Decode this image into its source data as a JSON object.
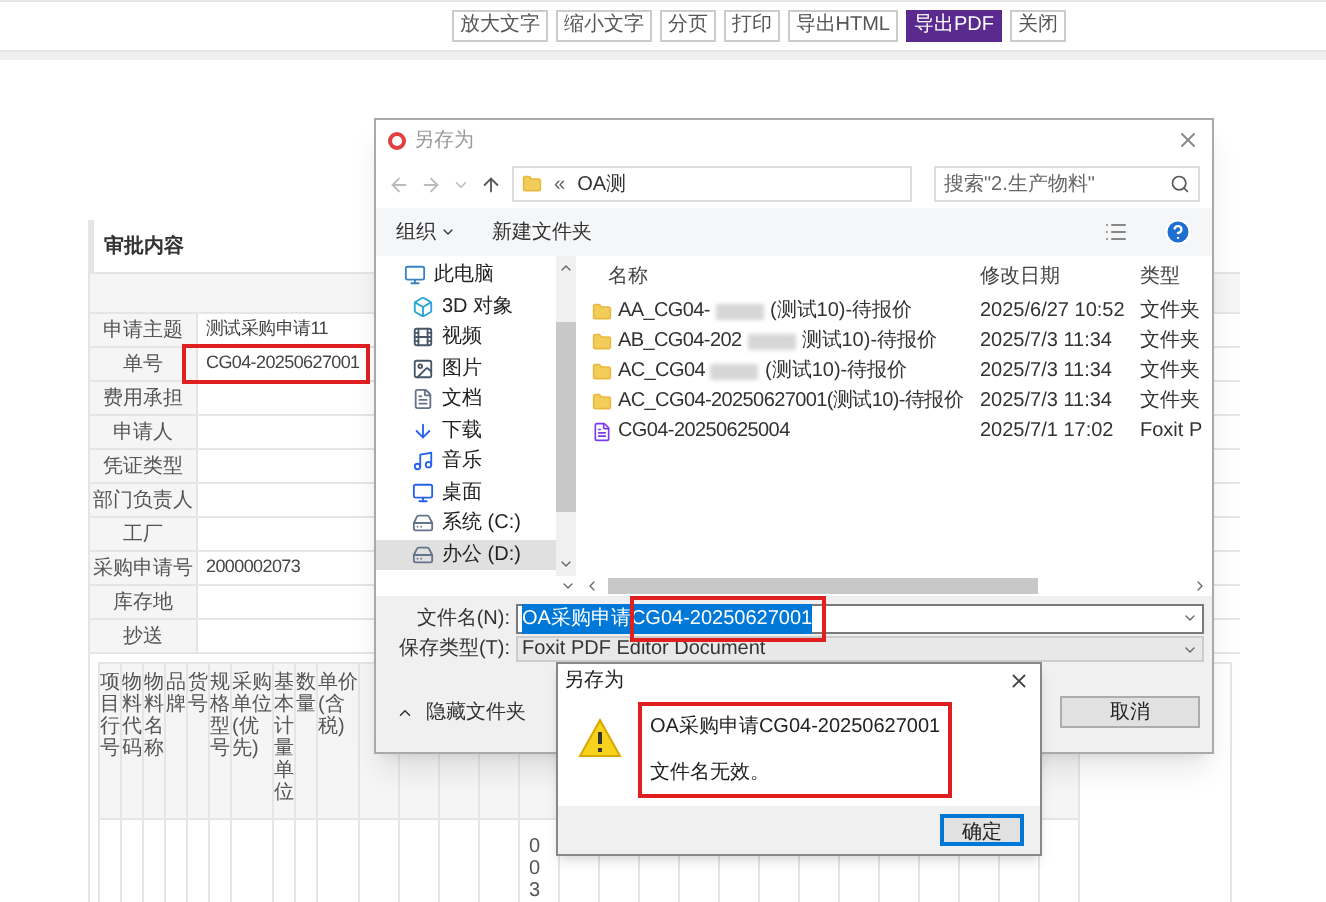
{
  "toolbar": {
    "buttons": [
      {
        "label": "放大文字",
        "selected": false
      },
      {
        "label": "缩小文字",
        "selected": false
      },
      {
        "label": "分页",
        "selected": false
      },
      {
        "label": "打印",
        "selected": false
      },
      {
        "label": "导出HTML",
        "selected": false
      },
      {
        "label": "导出PDF",
        "selected": true
      },
      {
        "label": "关闭",
        "selected": false
      }
    ]
  },
  "form": {
    "title": "审批内容",
    "fields": [
      {
        "label": "申请主题",
        "value": "测试采购申请11"
      },
      {
        "label": "单号",
        "value": "CG04-20250627001",
        "highlighted": true
      },
      {
        "label": "费用承担"
      },
      {
        "label": "申请人"
      },
      {
        "label": "凭证类型"
      },
      {
        "label": "部门负责人"
      },
      {
        "label": "工厂"
      },
      {
        "label": "采购申请号",
        "value": "2000002073"
      },
      {
        "label": "库存地"
      },
      {
        "label": "抄送"
      }
    ],
    "table": {
      "columns": [
        "项目行号",
        "物料代码",
        "物料名称",
        "品牌",
        "货号",
        "规格型号",
        "采购单位(优先)",
        "基本计量单位",
        "数量",
        "单价(含税)"
      ],
      "visible_cell": "003"
    }
  },
  "save_dialog": {
    "title": "另存为",
    "address_prefix": "«",
    "address": "OA测",
    "search_placeholder": "搜索\"2.生产物料\"",
    "toolbar": [
      "组织",
      "新建文件夹"
    ],
    "nav_items": [
      {
        "label": "此电脑",
        "kind": "pc",
        "selected": false
      },
      {
        "label": "3D 对象",
        "kind": "objects",
        "selected": false
      },
      {
        "label": "视频",
        "kind": "video",
        "selected": false
      },
      {
        "label": "图片",
        "kind": "pictures",
        "selected": false
      },
      {
        "label": "文档",
        "kind": "documents",
        "selected": false
      },
      {
        "label": "下载",
        "kind": "downloads",
        "selected": false
      },
      {
        "label": "音乐",
        "kind": "music",
        "selected": false
      },
      {
        "label": "桌面",
        "kind": "desktop",
        "selected": false
      },
      {
        "label": "系统 (C:)",
        "kind": "drive",
        "selected": false
      },
      {
        "label": "办公 (D:)",
        "kind": "drive",
        "selected": true
      }
    ],
    "columns": [
      "名称",
      "修改日期",
      "类型"
    ],
    "files": [
      {
        "kind": "folder",
        "name_start": "AA_CG04-",
        "name_end": "(测试10)-待报价",
        "date": "2025/6/27 10:52",
        "type": "文件夹"
      },
      {
        "kind": "folder",
        "name_start": "AB_CG04-202",
        "name_end": "测试10)-待报价",
        "date": "2025/7/3 11:34",
        "type": "文件夹"
      },
      {
        "kind": "folder",
        "name_start": "AC_CG04",
        "name_end": "(测试10)-待报价",
        "date": "2025/7/3 11:34",
        "type": "文件夹"
      },
      {
        "kind": "folder",
        "name_start": "AC_CG04-20250627001(测试10)-待报价",
        "date": "2025/7/3 11:34",
        "type": "文件夹"
      },
      {
        "kind": "pdf",
        "name_start": "CG04-20250625004",
        "date": "2025/7/1 17:02",
        "type": "Foxit P"
      }
    ],
    "file_name_label": "文件名(N):",
    "file_name": "OA采购申请CG04-20250627001",
    "file_name_highlighted": true,
    "save_type_label": "保存类型(T):",
    "save_type": "Foxit PDF Editor Document",
    "hide_folders": "隐藏文件夹",
    "cancel": "取消"
  },
  "alert": {
    "title": "另存为",
    "message": "OA采购申请CG04-20250627001",
    "detail": "文件名无效。",
    "highlighted": true,
    "ok": "确定"
  }
}
